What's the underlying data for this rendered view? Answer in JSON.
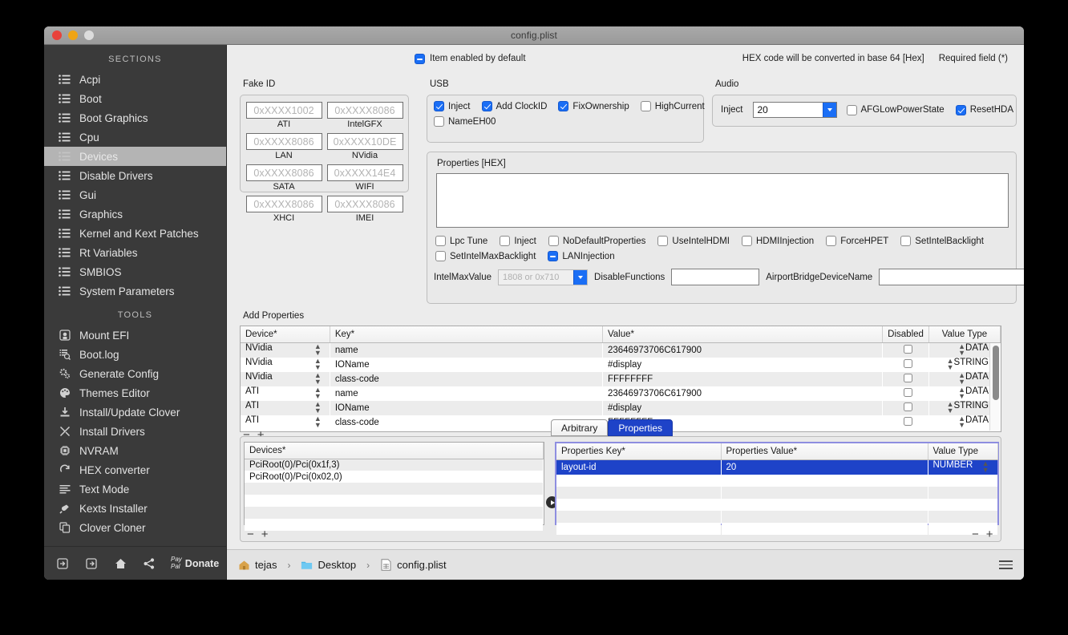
{
  "window": {
    "title": "config.plist"
  },
  "traffic_lights": [
    {
      "name": "close",
      "color": "#e8423b"
    },
    {
      "name": "minimize",
      "color": "#f0a415"
    },
    {
      "name": "zoom",
      "color": "#dcdcdc"
    }
  ],
  "sidebar": {
    "sections_header": "SECTIONS",
    "sections": [
      {
        "label": "Acpi",
        "icon": "list-icon",
        "selected": false
      },
      {
        "label": "Boot",
        "icon": "list-icon",
        "selected": false
      },
      {
        "label": "Boot Graphics",
        "icon": "list-icon",
        "selected": false
      },
      {
        "label": "Cpu",
        "icon": "list-icon",
        "selected": false
      },
      {
        "label": "Devices",
        "icon": "list-icon",
        "selected": true
      },
      {
        "label": "Disable Drivers",
        "icon": "list-icon",
        "selected": false
      },
      {
        "label": "Gui",
        "icon": "list-icon",
        "selected": false
      },
      {
        "label": "Graphics",
        "icon": "list-icon",
        "selected": false
      },
      {
        "label": "Kernel and Kext Patches",
        "icon": "list-icon",
        "selected": false
      },
      {
        "label": "Rt Variables",
        "icon": "list-icon",
        "selected": false
      },
      {
        "label": "SMBIOS",
        "icon": "list-icon",
        "selected": false
      },
      {
        "label": "System Parameters",
        "icon": "list-icon",
        "selected": false
      }
    ],
    "tools_header": "TOOLS",
    "tools": [
      {
        "label": "Mount EFI",
        "icon": "disk-icon"
      },
      {
        "label": "Boot.log",
        "icon": "log-search-icon"
      },
      {
        "label": "Generate Config",
        "icon": "gears-icon"
      },
      {
        "label": "Themes Editor",
        "icon": "palette-icon"
      },
      {
        "label": "Install/Update Clover",
        "icon": "download-icon"
      },
      {
        "label": "Install Drivers",
        "icon": "tools-icon"
      },
      {
        "label": "NVRAM",
        "icon": "chip-icon"
      },
      {
        "label": "HEX converter",
        "icon": "refresh-icon"
      },
      {
        "label": "Text Mode",
        "icon": "text-lines-icon"
      },
      {
        "label": "Kexts Installer",
        "icon": "plug-icon"
      },
      {
        "label": "Clover Cloner",
        "icon": "copy-icon"
      }
    ],
    "donate": {
      "paypal_line1": "Pay",
      "paypal_line2": "Pal",
      "label": "Donate",
      "icons": [
        "import-icon",
        "export-icon",
        "home-icon",
        "share-icon"
      ]
    }
  },
  "topbar": {
    "item_enabled_label": "Item enabled by default",
    "item_enabled_state": "mixed",
    "hex_note": "HEX code will be converted in base 64 [Hex]",
    "required_note": "Required field (*)"
  },
  "fake_id": {
    "label": "Fake ID",
    "fields": [
      {
        "caption": "ATI",
        "placeholder": "0xXXXX1002"
      },
      {
        "caption": "IntelGFX",
        "placeholder": "0xXXXX8086"
      },
      {
        "caption": "LAN",
        "placeholder": "0xXXXX8086"
      },
      {
        "caption": "NVidia",
        "placeholder": "0xXXXX10DE"
      },
      {
        "caption": "SATA",
        "placeholder": "0xXXXX8086"
      },
      {
        "caption": "WIFI",
        "placeholder": "0xXXXX14E4"
      },
      {
        "caption": "XHCI",
        "placeholder": "0xXXXX8086"
      },
      {
        "caption": "IMEI",
        "placeholder": "0xXXXX8086"
      }
    ]
  },
  "usb": {
    "label": "USB",
    "checkboxes": [
      {
        "label": "Inject",
        "state": "checked"
      },
      {
        "label": "Add ClockID",
        "state": "checked"
      },
      {
        "label": "FixOwnership",
        "state": "checked"
      },
      {
        "label": "HighCurrent",
        "state": "unchecked"
      },
      {
        "label": "NameEH00",
        "state": "unchecked"
      }
    ]
  },
  "audio": {
    "label": "Audio",
    "inject_label": "Inject",
    "inject_value": "20",
    "checkboxes": [
      {
        "label": "AFGLowPowerState",
        "state": "unchecked"
      },
      {
        "label": "ResetHDA",
        "state": "checked"
      }
    ]
  },
  "properties_hex": {
    "label": "Properties [HEX]",
    "textarea_value": "",
    "checkboxes_row1": [
      {
        "label": "Lpc Tune",
        "state": "unchecked"
      },
      {
        "label": "Inject",
        "state": "unchecked"
      },
      {
        "label": "NoDefaultProperties",
        "state": "unchecked"
      },
      {
        "label": "UseIntelHDMI",
        "state": "unchecked"
      },
      {
        "label": "HDMIInjection",
        "state": "unchecked"
      },
      {
        "label": "ForceHPET",
        "state": "unchecked"
      },
      {
        "label": "SetIntelBacklight",
        "state": "unchecked"
      }
    ],
    "checkboxes_row2": [
      {
        "label": "SetIntelMaxBacklight",
        "state": "unchecked"
      },
      {
        "label": "LANInjection",
        "state": "mixed"
      }
    ],
    "intel_max_value_label": "IntelMaxValue",
    "intel_max_value_placeholder": "1808 or 0x710",
    "disable_functions_label": "DisableFunctions",
    "disable_functions_value": "",
    "airport_label": "AirportBridgeDeviceName",
    "airport_value": ""
  },
  "add_properties": {
    "label": "Add Properties",
    "columns": [
      "Device*",
      "Key*",
      "Value*",
      "Disabled",
      "Value Type"
    ],
    "rows": [
      {
        "device": "NVidia",
        "key": "name",
        "value": "23646973706C617900",
        "disabled": false,
        "value_type": "DATA"
      },
      {
        "device": "NVidia",
        "key": "IOName",
        "value": "#display",
        "disabled": false,
        "value_type": "STRING"
      },
      {
        "device": "NVidia",
        "key": "class-code",
        "value": "FFFFFFFF",
        "disabled": false,
        "value_type": "DATA"
      },
      {
        "device": "ATI",
        "key": "name",
        "value": "23646973706C617900",
        "disabled": false,
        "value_type": "DATA"
      },
      {
        "device": "ATI",
        "key": "IOName",
        "value": "#display",
        "disabled": false,
        "value_type": "STRING"
      },
      {
        "device": "ATI",
        "key": "class-code",
        "value": "FFFFFFFF",
        "disabled": false,
        "value_type": "DATA"
      }
    ],
    "remove_label": "−",
    "add_label": "+"
  },
  "tabs": [
    {
      "label": "Arbitrary",
      "active": false
    },
    {
      "label": "Properties",
      "active": true
    }
  ],
  "devices_table": {
    "column": "Devices*",
    "rows": [
      {
        "path": "PciRoot(0)/Pci(0x1f,3)"
      },
      {
        "path": "PciRoot(0)/Pci(0x02,0)"
      }
    ],
    "remove_label": "−",
    "add_label": "+"
  },
  "properties_table": {
    "columns": [
      "Properties Key*",
      "Properties Value*",
      "Value Type"
    ],
    "rows": [
      {
        "key": "layout-id",
        "value": "20",
        "value_type": "NUMBER",
        "selected": true
      }
    ],
    "remove_label": "−",
    "add_label": "+"
  },
  "statusbar": {
    "breadcrumb": [
      {
        "label": "tejas",
        "icon": "home-folder-icon"
      },
      {
        "label": "Desktop",
        "icon": "folder-icon"
      },
      {
        "label": "config.plist",
        "icon": "file-icon"
      }
    ],
    "separator": "›"
  },
  "colors": {
    "accent_blue": "#1a6ef5",
    "tab_blue": "#1e43c8",
    "sidebar_bg": "#3a3a3a",
    "selected_row": "#b4b4b4",
    "window_bg": "#ececec"
  }
}
